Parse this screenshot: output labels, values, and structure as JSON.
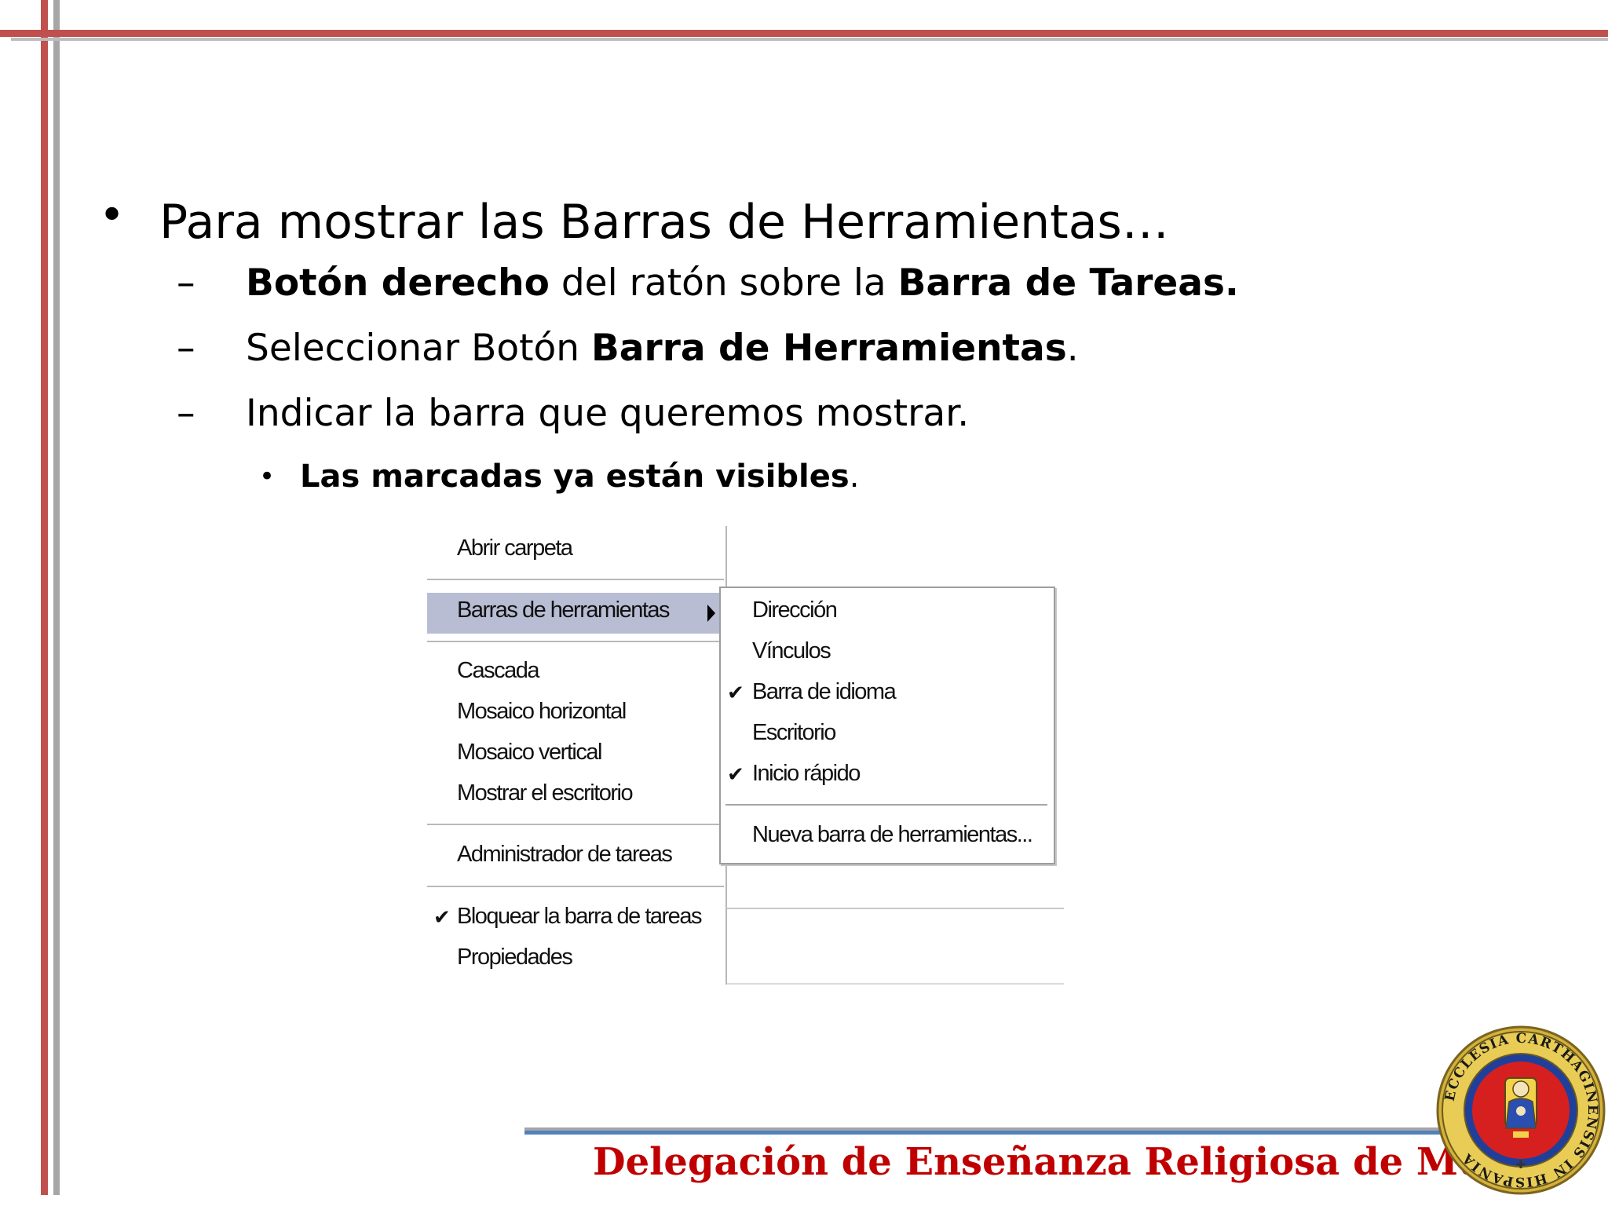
{
  "slide": {
    "bullet1": "Para mostrar las Barras de Herramientas…",
    "sub1": {
      "bold1": "Botón derecho",
      "rest": " del ratón sobre la ",
      "bold2": "Barra de Tareas."
    },
    "sub2": {
      "text": "Seleccionar Botón ",
      "bold": "Barra de Herramientas",
      "end": "."
    },
    "sub3": {
      "text": "Indicar la barra que queremos mostrar."
    },
    "sub3_1": {
      "bold": "Las marcadas ya están visibles",
      "end": "."
    },
    "dash": "–",
    "dot": "•"
  },
  "context_menu": {
    "items": [
      "Abrir carpeta",
      "Barras de herramientas",
      "Cascada",
      "Mosaico horizontal",
      "Mosaico vertical",
      "Mostrar el escritorio",
      "Administrador de tareas",
      "Bloquear la barra de tareas",
      "Propiedades"
    ],
    "selected": "Barras de herramientas",
    "checked": [
      "Bloquear la barra de tareas"
    ],
    "check_glyph": "✔"
  },
  "submenu": {
    "items": [
      "Dirección",
      "Vínculos",
      "Barra de idioma",
      "Escritorio",
      "Inicio rápido",
      "Nueva barra de herramientas..."
    ],
    "checked": [
      "Barra de idioma",
      "Inicio rápido"
    ]
  },
  "footer": {
    "text": "Delegación de Enseñanza Religiosa de Murcia",
    "seal_text": "ECCLESIA CARTHAGINENSIS IN HISPANIA"
  },
  "colors": {
    "accent_red": "#c0504d",
    "footer_red": "#c00000",
    "footer_blue": "#4f81bd",
    "menu_highlight": "#b8bdd4"
  }
}
